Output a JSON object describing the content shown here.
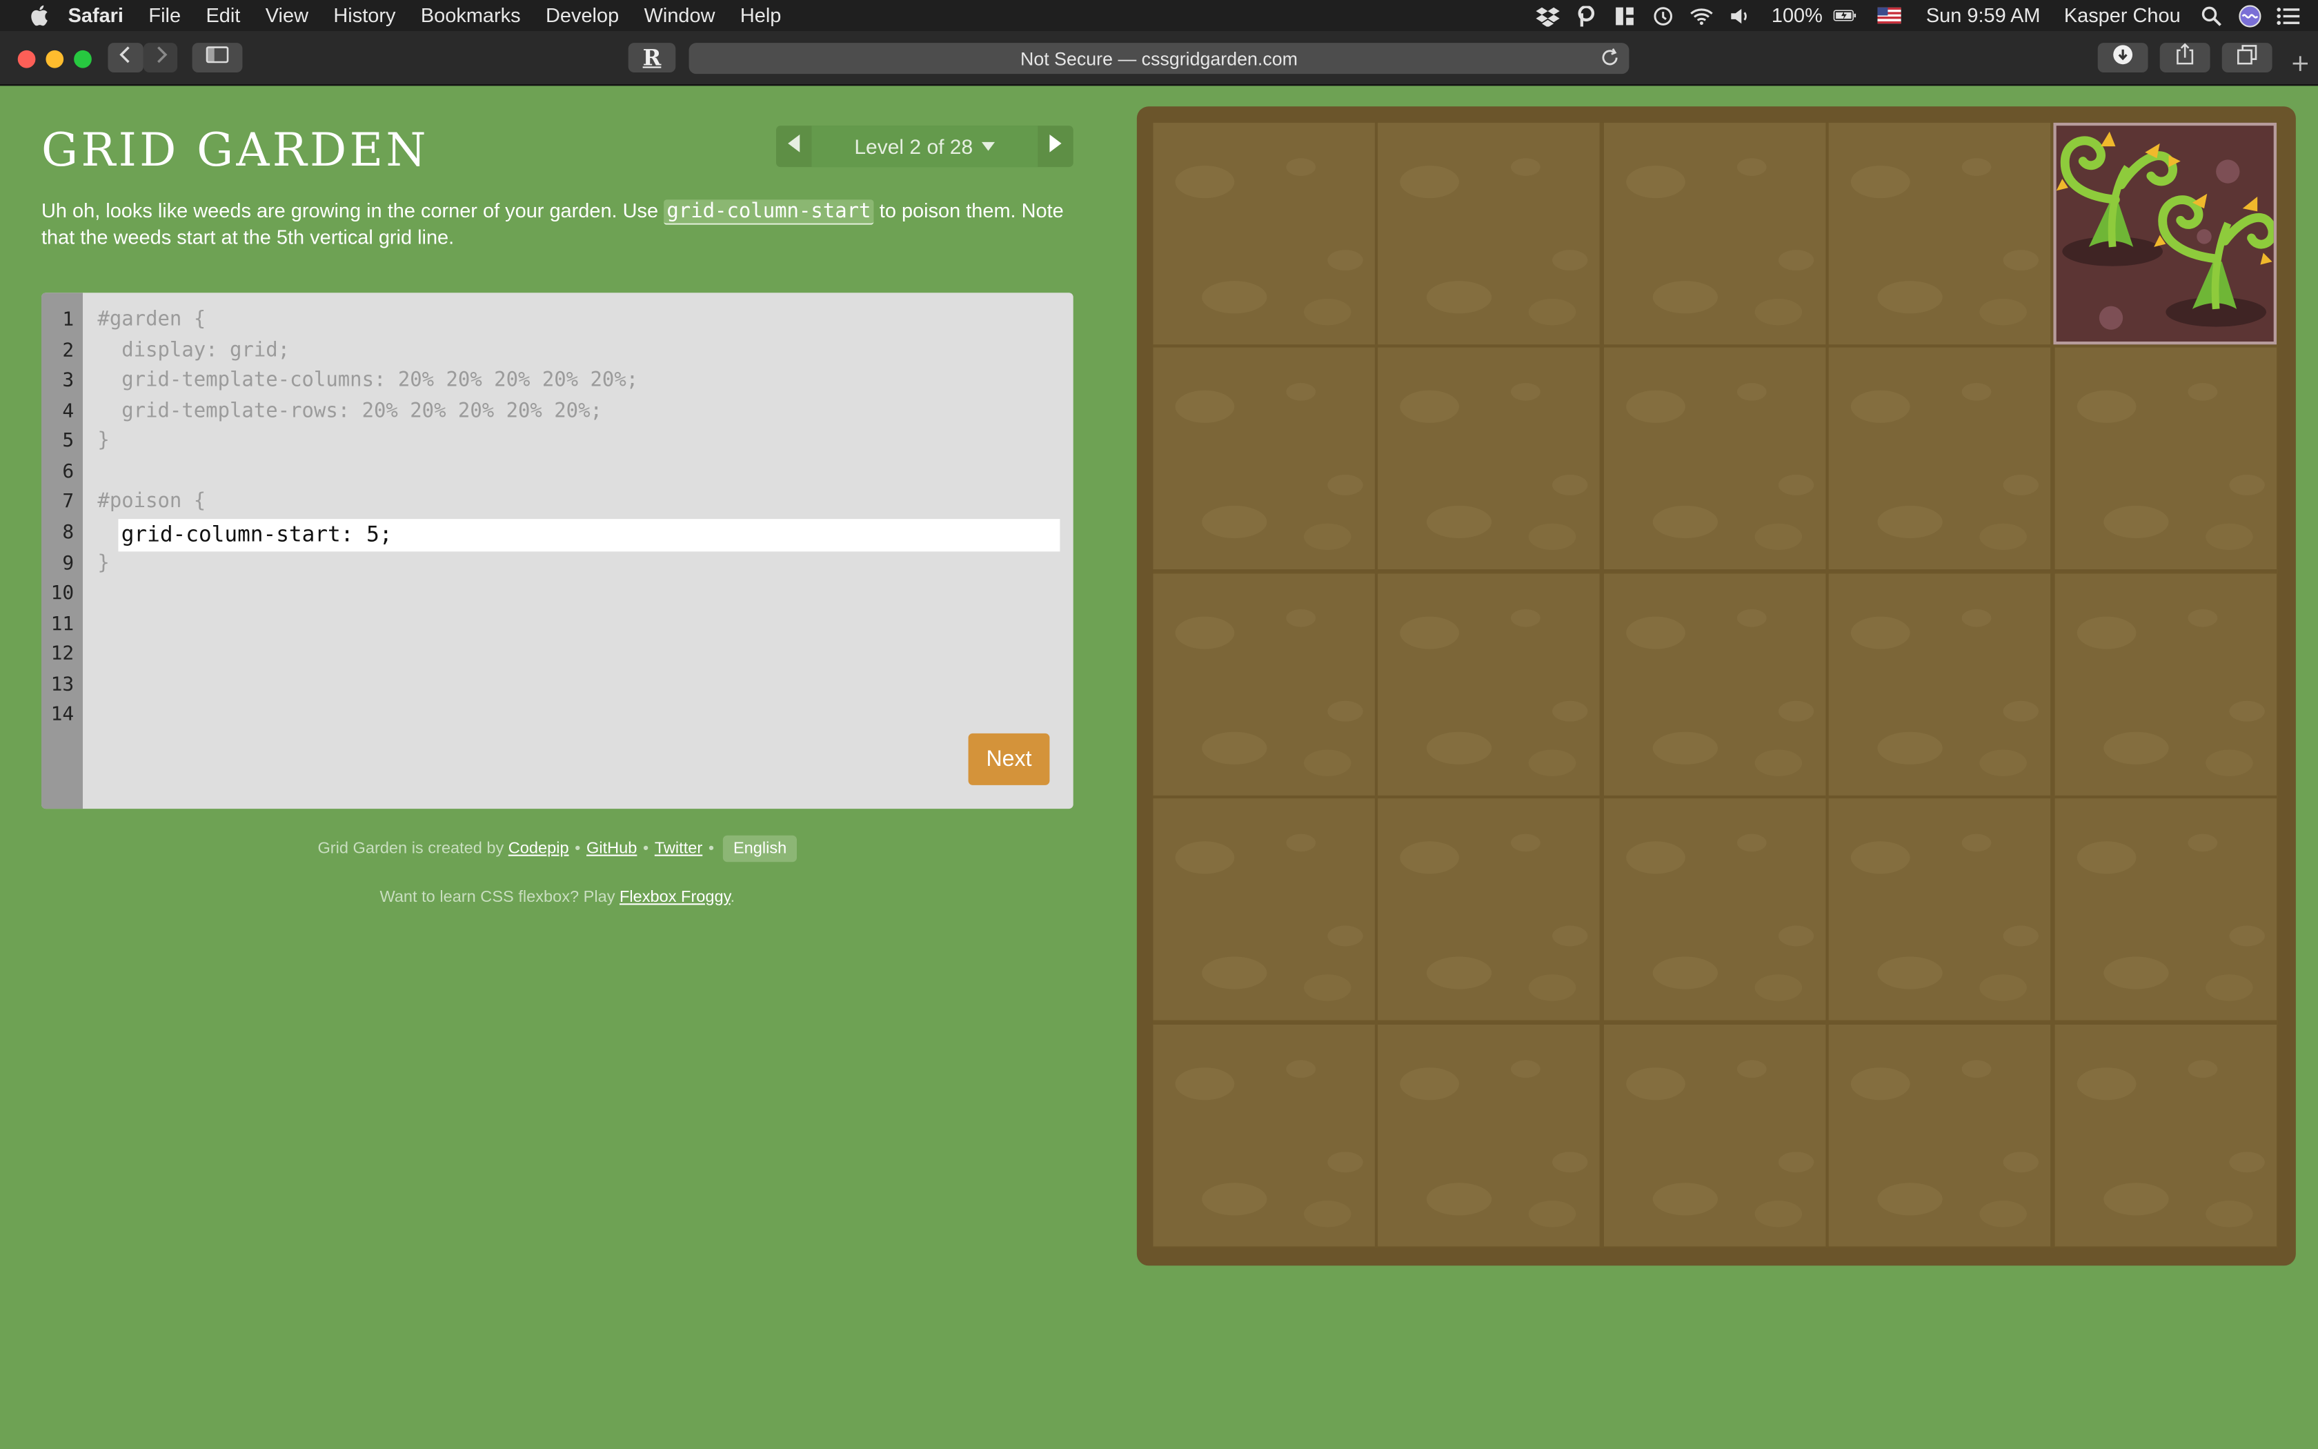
{
  "menubar": {
    "app_name": "Safari",
    "menus": [
      "File",
      "Edit",
      "View",
      "History",
      "Bookmarks",
      "Develop",
      "Window",
      "Help"
    ],
    "battery": "100%",
    "clock": "Sun 9:59 AM",
    "user": "Kasper Chou"
  },
  "toolbar": {
    "reader_label": "R",
    "url_text": "Not Secure — cssgridgarden.com"
  },
  "game": {
    "title": "GRID GARDEN",
    "level_label": "Level 2 of 28",
    "instructions": {
      "part1": "Uh oh, looks like weeds are growing in the corner of your garden. Use ",
      "code_word": "grid-column-start",
      "part2": " to poison them. Note that the weeds start at the 5th vertical grid line."
    },
    "editor": {
      "line_numbers": [
        "1",
        "2",
        "3",
        "4",
        "5",
        "6",
        "7",
        "8",
        "9",
        "10",
        "11",
        "12",
        "13",
        "14"
      ],
      "lines": [
        "#garden {",
        "  display: grid;",
        "  grid-template-columns: 20% 20% 20% 20% 20%;",
        "  grid-template-rows: 20% 20% 20% 20% 20%;",
        "}",
        "",
        "#poison {",
        "",
        "}"
      ],
      "input_value": "grid-column-start: 5;",
      "next_label": "Next"
    },
    "footer": {
      "created_by": "Grid Garden is created by",
      "codepip": "Codepip",
      "github": "GitHub",
      "twitter": "Twitter",
      "language": "English",
      "flexbox_prompt": "Want to learn CSS flexbox? Play",
      "flexbox_link": "Flexbox Froggy",
      "period": "."
    }
  },
  "colors": {
    "background": "#6ea254",
    "garden_border": "#6b552b",
    "soil": "#7c6638",
    "poison": "#5c3534",
    "next_button": "#d4933a"
  }
}
